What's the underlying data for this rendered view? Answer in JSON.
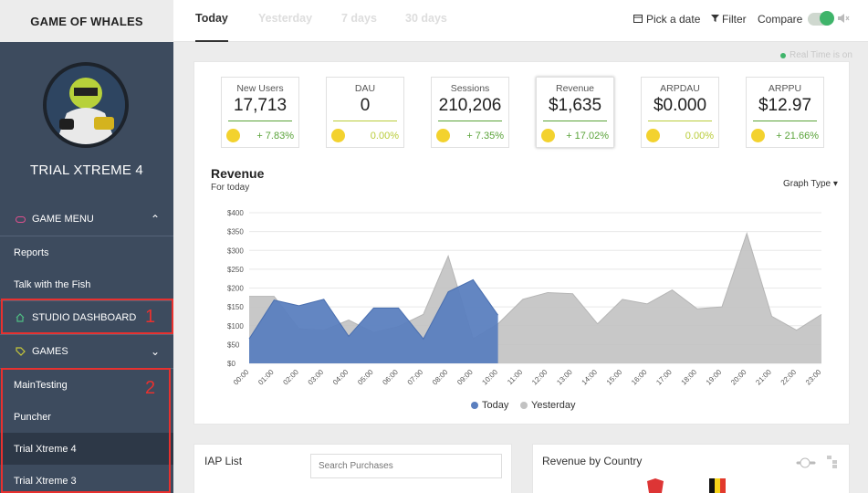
{
  "sidebar": {
    "brand": "GAME OF WHALES",
    "app_name": "TRIAL XTREME 4",
    "menu": {
      "game_menu": "GAME MENU",
      "reports": "Reports",
      "talk": "Talk with the Fish",
      "studio": "STUDIO DASHBOARD",
      "games": "GAMES",
      "game_items": [
        "MainTesting",
        "Puncher",
        "Trial Xtreme 4",
        "Trial Xtreme 3"
      ]
    },
    "annotations": [
      "1",
      "2"
    ]
  },
  "topbar": {
    "tabs": [
      "Today",
      "Yesterday",
      "7 days",
      "30 days"
    ],
    "pick_date": "Pick a date",
    "filter": "Filter",
    "compare": "Compare"
  },
  "realtime": "Real Time is on",
  "kpis": [
    {
      "label": "New Users",
      "value": "17,713",
      "change": "+ 7.83%",
      "color": "#5aa339"
    },
    {
      "label": "DAU",
      "value": "0",
      "change": "0.00%",
      "color": "#b9cc3a"
    },
    {
      "label": "Sessions",
      "value": "210,206",
      "change": "+ 7.35%",
      "color": "#5aa339"
    },
    {
      "label": "Revenue",
      "value": "$1,635",
      "change": "+ 17.02%",
      "color": "#5aa339"
    },
    {
      "label": "ARPDAU",
      "value": "$0.000",
      "change": "0.00%",
      "color": "#b9cc3a"
    },
    {
      "label": "ARPPU",
      "value": "$12.97",
      "change": "+ 21.66%",
      "color": "#5aa339"
    }
  ],
  "revenue": {
    "title": "Revenue",
    "subtitle": "For today",
    "graph_type": "Graph Type"
  },
  "chart_data": {
    "type": "area",
    "x": [
      "00:00",
      "01:00",
      "02:00",
      "03:00",
      "04:00",
      "05:00",
      "06:00",
      "07:00",
      "08:00",
      "09:00",
      "10:00",
      "11:00",
      "12:00",
      "13:00",
      "14:00",
      "15:00",
      "16:00",
      "17:00",
      "18:00",
      "19:00",
      "20:00",
      "21:00",
      "22:00",
      "23:00"
    ],
    "ylim": [
      0,
      400
    ],
    "yticks": [
      "$0",
      "$50",
      "$100",
      "$150",
      "$200",
      "$250",
      "$300",
      "$350",
      "$400"
    ],
    "series": [
      {
        "name": "Today",
        "color": "#5b7fbf",
        "values": [
          65,
          168,
          153,
          170,
          72,
          147,
          147,
          65,
          190,
          222,
          128
        ]
      },
      {
        "name": "Yesterday",
        "color": "#c2c2c2",
        "values": [
          178,
          178,
          92,
          88,
          115,
          82,
          98,
          130,
          285,
          65,
          105,
          170,
          188,
          185,
          105,
          170,
          158,
          195,
          145,
          150,
          345,
          125,
          88,
          130
        ]
      }
    ],
    "grid": true,
    "legend": "bottom"
  },
  "bottom": {
    "iap_title": "IAP List",
    "search_placeholder": "Search Purchases",
    "country_title": "Revenue by Country"
  }
}
